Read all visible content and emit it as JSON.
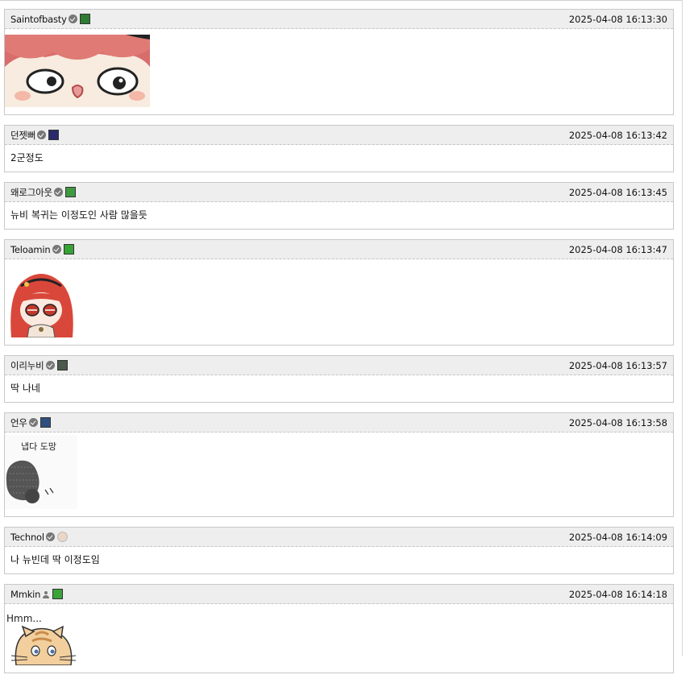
{
  "comments": [
    {
      "user": "Saintofbasty",
      "time": "2025-04-08 16:13:30",
      "type": "image",
      "sticker": "red-haired-girl-closeup-sticker",
      "badge": {
        "icon": "tree-badge-icon",
        "color": "#2e7d32"
      }
    },
    {
      "user": "던젯뻐",
      "time": "2025-04-08 16:13:42",
      "type": "text",
      "text": "2군정도",
      "badge": {
        "icon": "pixel-knight-badge-icon",
        "color": "#2a2a6a"
      }
    },
    {
      "user": "왜로그아웃",
      "time": "2025-04-08 16:13:45",
      "type": "text",
      "text": "뉴비 복귀는 이정도인 사람 많을듯",
      "badge": {
        "icon": "green-block-badge-icon",
        "color": "#3f9a3f"
      }
    },
    {
      "user": "Teloamin",
      "time": "2025-04-08 16:13:47",
      "type": "image",
      "sticker": "crying-red-haired-girl-sticker",
      "badge": {
        "icon": "creeper-badge-icon",
        "color": "#36a336"
      }
    },
    {
      "user": "이리누비",
      "time": "2025-04-08 16:13:57",
      "type": "text",
      "text": "딱 나네",
      "badge": {
        "icon": "house-badge-icon",
        "color": "#4a5a4a"
      }
    },
    {
      "user": "언우",
      "time": "2025-04-08 16:13:58",
      "type": "image",
      "sticker": "run-away-sticker",
      "sticker_caption": "냅다 도망",
      "badge": {
        "icon": "blue-pixel-badge-icon",
        "color": "#2f4f7f"
      }
    },
    {
      "user": "Technol",
      "time": "2025-04-08 16:14:09",
      "type": "text",
      "text": "나 뉴빈데 딱 이정도임",
      "badge": {
        "icon": "avatar-badge-icon",
        "color": "#e9d7c8"
      }
    },
    {
      "user": "Mmkin",
      "time": "2025-04-08 16:14:18",
      "type": "image",
      "sticker": "hmm-cat-sticker",
      "sticker_caption": "Hmm...",
      "badge": {
        "icon": "green-cross-badge-icon",
        "color": "#3aa33a"
      }
    }
  ]
}
